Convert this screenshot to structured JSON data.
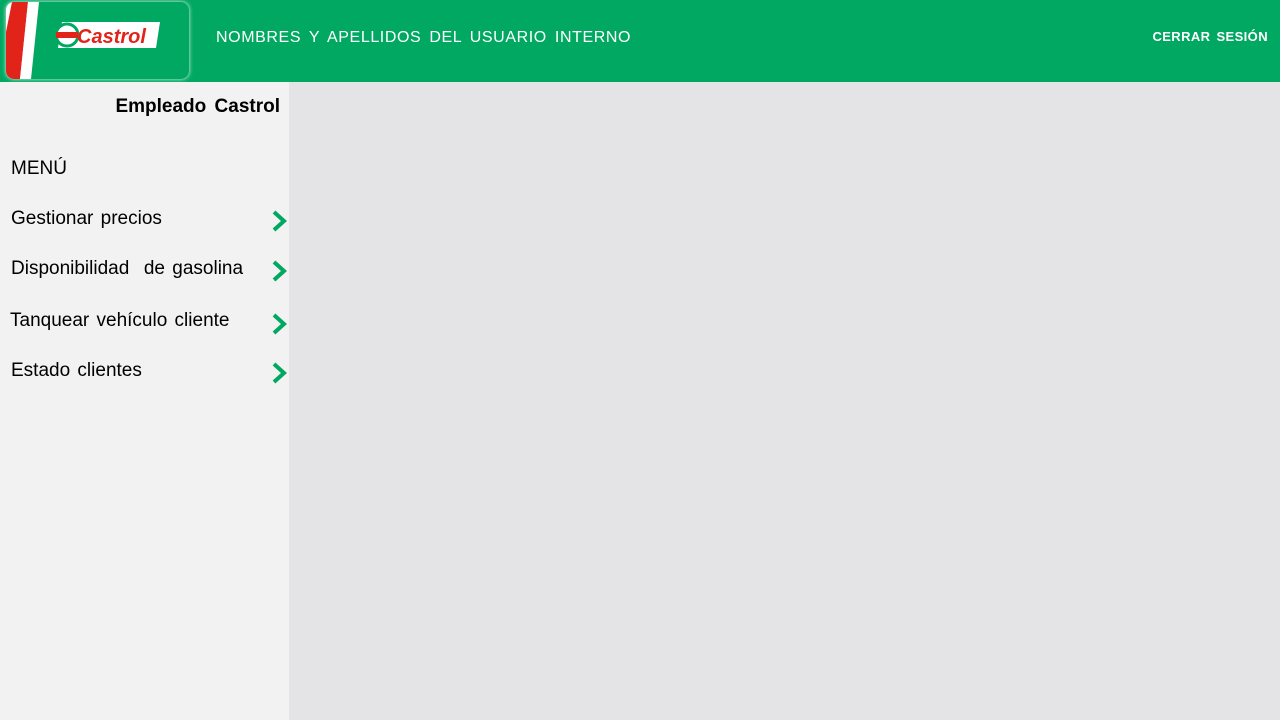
{
  "header": {
    "logo_text": "Castrol",
    "user_name": "NOMBRES Y APELLIDOS DEL USUARIO INTERNO",
    "logout_label": "CERRAR SESIÓN"
  },
  "sidebar": {
    "role": "Empleado Castrol",
    "menu_title": "MENÚ",
    "items": [
      {
        "label": "Gestionar precios",
        "icon": "chevron-right-icon"
      },
      {
        "label": "Disponibilidad  de gasolina",
        "icon": "chevron-right-icon"
      },
      {
        "label": "Tanquear vehículo cliente",
        "icon": "chevron-right-icon"
      },
      {
        "label": "Estado clientes",
        "icon": "chevron-right-icon"
      }
    ]
  },
  "colors": {
    "brand_green": "#00a862",
    "brand_red": "#e2231a",
    "sidebar_bg": "#f2f2f2",
    "content_bg": "#e4e4e6"
  }
}
